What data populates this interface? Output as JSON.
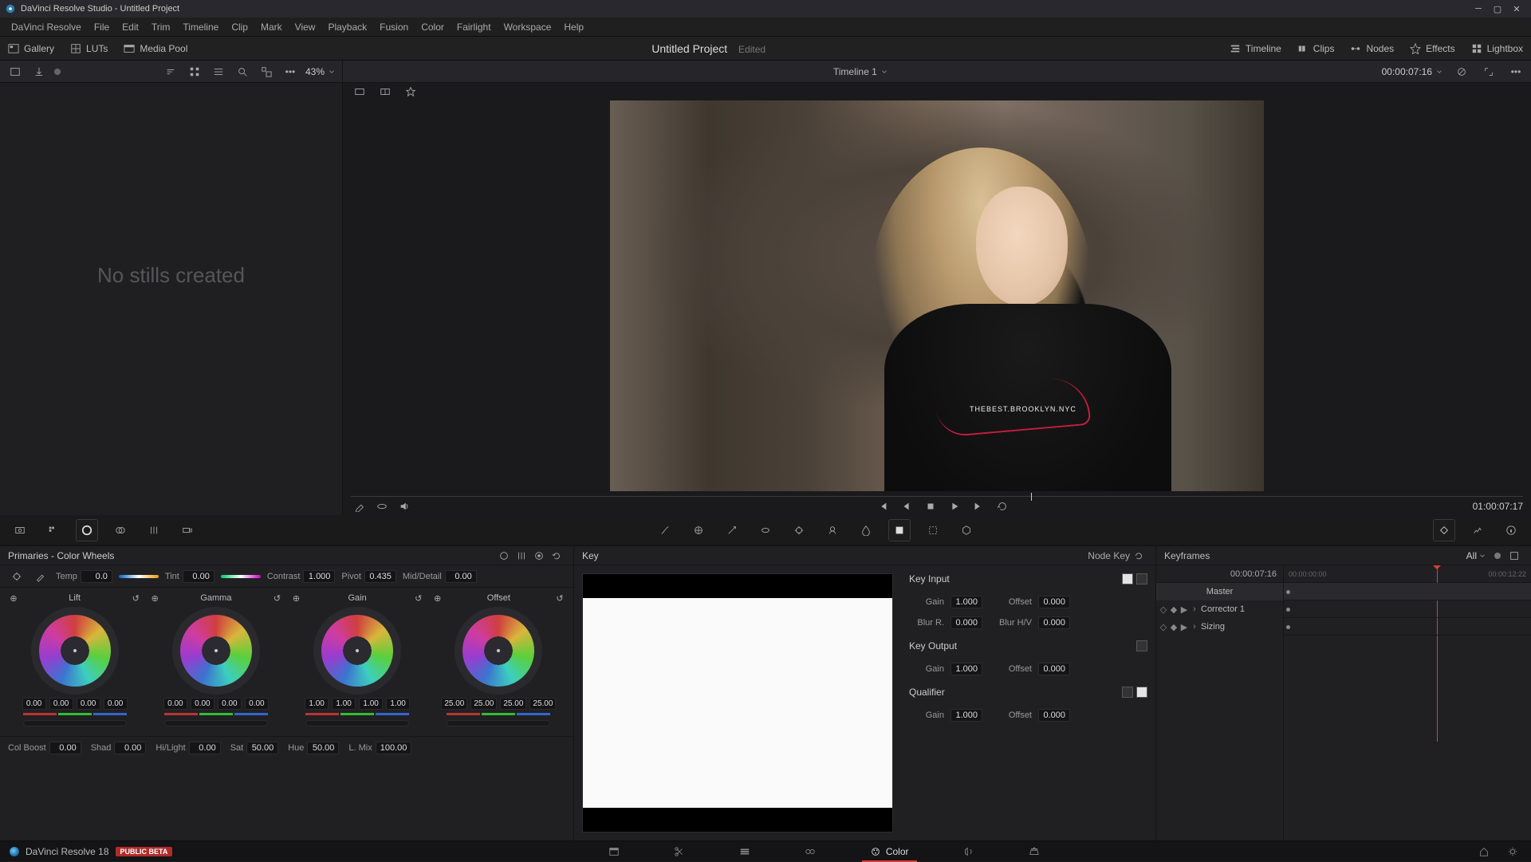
{
  "window": {
    "title": "DaVinci Resolve Studio - Untitled Project"
  },
  "menu": [
    "DaVinci Resolve",
    "File",
    "Edit",
    "Trim",
    "Timeline",
    "Clip",
    "Mark",
    "View",
    "Playback",
    "Fusion",
    "Color",
    "Fairlight",
    "Workspace",
    "Help"
  ],
  "header": {
    "gallery": "Gallery",
    "luts": "LUTs",
    "media_pool": "Media Pool",
    "project_title": "Untitled Project",
    "edited": "Edited",
    "timeline": "Timeline",
    "clips": "Clips",
    "nodes": "Nodes",
    "effects": "Effects",
    "lightbox": "Lightbox"
  },
  "gallery_sub": {
    "zoom": "43%",
    "timeline_name": "Timeline 1",
    "main_tc": "00:00:07:16"
  },
  "gallery_empty": "No stills created",
  "viewer": {
    "brand_text": "THEBEST.BROOKLYN.NYC",
    "play_tc": "01:00:07:17"
  },
  "primaries": {
    "title": "Primaries - Color Wheels",
    "temp_label": "Temp",
    "temp": "0.0",
    "tint_label": "Tint",
    "tint": "0.00",
    "contrast_label": "Contrast",
    "contrast": "1.000",
    "pivot_label": "Pivot",
    "pivot": "0.435",
    "md_label": "Mid/Detail",
    "md": "0.00",
    "wheels": [
      {
        "name": "Lift",
        "vals": [
          "0.00",
          "0.00",
          "0.00",
          "0.00"
        ]
      },
      {
        "name": "Gamma",
        "vals": [
          "0.00",
          "0.00",
          "0.00",
          "0.00"
        ]
      },
      {
        "name": "Gain",
        "vals": [
          "1.00",
          "1.00",
          "1.00",
          "1.00"
        ]
      },
      {
        "name": "Offset",
        "vals": [
          "25.00",
          "25.00",
          "25.00",
          "25.00"
        ]
      }
    ],
    "adjust": [
      {
        "l": "Col Boost",
        "v": "0.00"
      },
      {
        "l": "Shad",
        "v": "0.00"
      },
      {
        "l": "Hi/Light",
        "v": "0.00"
      },
      {
        "l": "Sat",
        "v": "50.00"
      },
      {
        "l": "Hue",
        "v": "50.00"
      },
      {
        "l": "L. Mix",
        "v": "100.00"
      }
    ]
  },
  "key": {
    "title": "Key",
    "nodekey": "Node Key",
    "input": {
      "title": "Key Input",
      "gain_l": "Gain",
      "gain": "1.000",
      "offset_l": "Offset",
      "offset": "0.000",
      "blurr_l": "Blur R.",
      "blurr": "0.000",
      "blurhv_l": "Blur H/V",
      "blurhv": "0.000"
    },
    "output": {
      "title": "Key Output",
      "gain_l": "Gain",
      "gain": "1.000",
      "offset_l": "Offset",
      "offset": "0.000"
    },
    "qualifier": {
      "title": "Qualifier",
      "gain_l": "Gain",
      "gain": "1.000",
      "offset_l": "Offset",
      "offset": "0.000"
    }
  },
  "keyframes": {
    "title": "Keyframes",
    "all": "All",
    "tc": "00:00:07:16",
    "ruler": [
      "00:00:00:00",
      "00:00:12:22"
    ],
    "rows": [
      "Master",
      "Corrector 1",
      "Sizing"
    ]
  },
  "pagebar": {
    "product": "DaVinci Resolve 18",
    "beta": "PUBLIC BETA",
    "pages": [
      "Media",
      "Cut",
      "Edit",
      "Fusion",
      "Color",
      "Fairlight",
      "Deliver"
    ],
    "active": "Color"
  }
}
